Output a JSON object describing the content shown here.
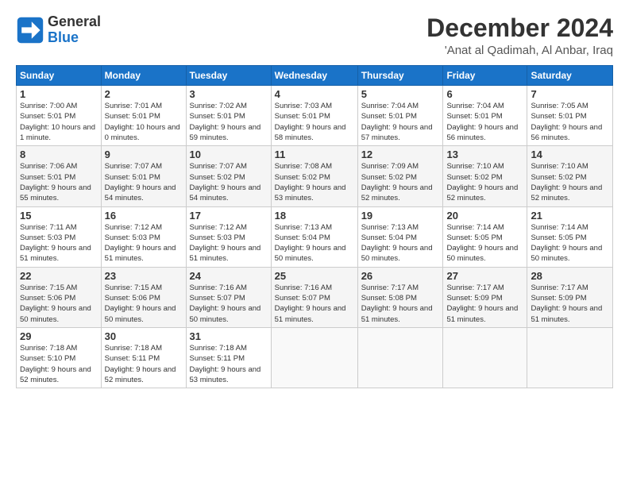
{
  "header": {
    "logo_general": "General",
    "logo_blue": "Blue",
    "month_title": "December 2024",
    "location": "'Anat al Qadimah, Al Anbar, Iraq"
  },
  "days_of_week": [
    "Sunday",
    "Monday",
    "Tuesday",
    "Wednesday",
    "Thursday",
    "Friday",
    "Saturday"
  ],
  "weeks": [
    [
      {
        "num": "1",
        "sunrise": "7:00 AM",
        "sunset": "5:01 PM",
        "daylight": "10 hours and 1 minute."
      },
      {
        "num": "2",
        "sunrise": "7:01 AM",
        "sunset": "5:01 PM",
        "daylight": "10 hours and 0 minutes."
      },
      {
        "num": "3",
        "sunrise": "7:02 AM",
        "sunset": "5:01 PM",
        "daylight": "9 hours and 59 minutes."
      },
      {
        "num": "4",
        "sunrise": "7:03 AM",
        "sunset": "5:01 PM",
        "daylight": "9 hours and 58 minutes."
      },
      {
        "num": "5",
        "sunrise": "7:04 AM",
        "sunset": "5:01 PM",
        "daylight": "9 hours and 57 minutes."
      },
      {
        "num": "6",
        "sunrise": "7:04 AM",
        "sunset": "5:01 PM",
        "daylight": "9 hours and 56 minutes."
      },
      {
        "num": "7",
        "sunrise": "7:05 AM",
        "sunset": "5:01 PM",
        "daylight": "9 hours and 56 minutes."
      }
    ],
    [
      {
        "num": "8",
        "sunrise": "7:06 AM",
        "sunset": "5:01 PM",
        "daylight": "9 hours and 55 minutes."
      },
      {
        "num": "9",
        "sunrise": "7:07 AM",
        "sunset": "5:01 PM",
        "daylight": "9 hours and 54 minutes."
      },
      {
        "num": "10",
        "sunrise": "7:07 AM",
        "sunset": "5:02 PM",
        "daylight": "9 hours and 54 minutes."
      },
      {
        "num": "11",
        "sunrise": "7:08 AM",
        "sunset": "5:02 PM",
        "daylight": "9 hours and 53 minutes."
      },
      {
        "num": "12",
        "sunrise": "7:09 AM",
        "sunset": "5:02 PM",
        "daylight": "9 hours and 52 minutes."
      },
      {
        "num": "13",
        "sunrise": "7:10 AM",
        "sunset": "5:02 PM",
        "daylight": "9 hours and 52 minutes."
      },
      {
        "num": "14",
        "sunrise": "7:10 AM",
        "sunset": "5:02 PM",
        "daylight": "9 hours and 52 minutes."
      }
    ],
    [
      {
        "num": "15",
        "sunrise": "7:11 AM",
        "sunset": "5:03 PM",
        "daylight": "9 hours and 51 minutes."
      },
      {
        "num": "16",
        "sunrise": "7:12 AM",
        "sunset": "5:03 PM",
        "daylight": "9 hours and 51 minutes."
      },
      {
        "num": "17",
        "sunrise": "7:12 AM",
        "sunset": "5:03 PM",
        "daylight": "9 hours and 51 minutes."
      },
      {
        "num": "18",
        "sunrise": "7:13 AM",
        "sunset": "5:04 PM",
        "daylight": "9 hours and 50 minutes."
      },
      {
        "num": "19",
        "sunrise": "7:13 AM",
        "sunset": "5:04 PM",
        "daylight": "9 hours and 50 minutes."
      },
      {
        "num": "20",
        "sunrise": "7:14 AM",
        "sunset": "5:05 PM",
        "daylight": "9 hours and 50 minutes."
      },
      {
        "num": "21",
        "sunrise": "7:14 AM",
        "sunset": "5:05 PM",
        "daylight": "9 hours and 50 minutes."
      }
    ],
    [
      {
        "num": "22",
        "sunrise": "7:15 AM",
        "sunset": "5:06 PM",
        "daylight": "9 hours and 50 minutes."
      },
      {
        "num": "23",
        "sunrise": "7:15 AM",
        "sunset": "5:06 PM",
        "daylight": "9 hours and 50 minutes."
      },
      {
        "num": "24",
        "sunrise": "7:16 AM",
        "sunset": "5:07 PM",
        "daylight": "9 hours and 50 minutes."
      },
      {
        "num": "25",
        "sunrise": "7:16 AM",
        "sunset": "5:07 PM",
        "daylight": "9 hours and 51 minutes."
      },
      {
        "num": "26",
        "sunrise": "7:17 AM",
        "sunset": "5:08 PM",
        "daylight": "9 hours and 51 minutes."
      },
      {
        "num": "27",
        "sunrise": "7:17 AM",
        "sunset": "5:09 PM",
        "daylight": "9 hours and 51 minutes."
      },
      {
        "num": "28",
        "sunrise": "7:17 AM",
        "sunset": "5:09 PM",
        "daylight": "9 hours and 51 minutes."
      }
    ],
    [
      {
        "num": "29",
        "sunrise": "7:18 AM",
        "sunset": "5:10 PM",
        "daylight": "9 hours and 52 minutes."
      },
      {
        "num": "30",
        "sunrise": "7:18 AM",
        "sunset": "5:11 PM",
        "daylight": "9 hours and 52 minutes."
      },
      {
        "num": "31",
        "sunrise": "7:18 AM",
        "sunset": "5:11 PM",
        "daylight": "9 hours and 53 minutes."
      },
      null,
      null,
      null,
      null
    ]
  ],
  "labels": {
    "sunrise": "Sunrise:",
    "sunset": "Sunset:",
    "daylight": "Daylight:"
  }
}
